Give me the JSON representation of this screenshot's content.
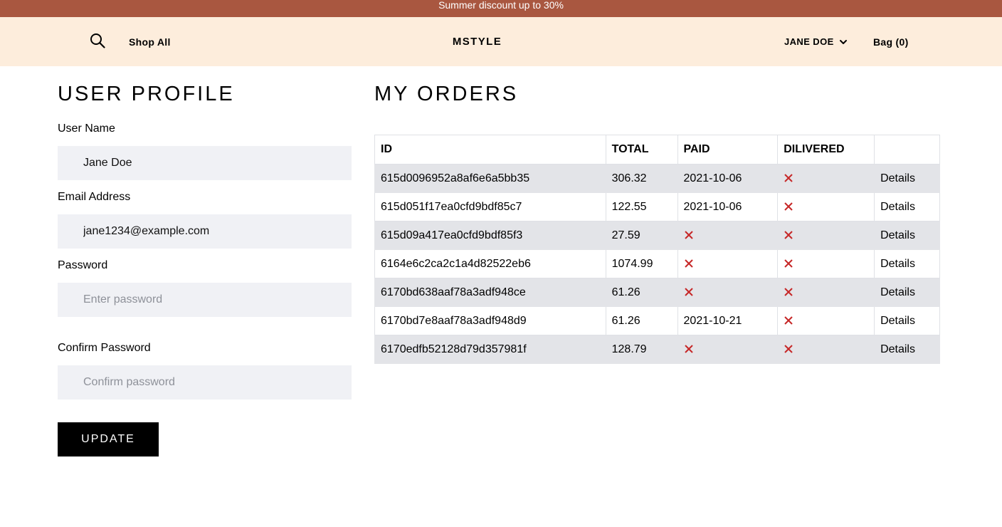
{
  "promo": {
    "text": "Summer discount up to 30%"
  },
  "header": {
    "shop_all": "Shop All",
    "brand": "MSTYLE",
    "user_name": "JANE DOE",
    "bag": "Bag (0)"
  },
  "profile": {
    "title": "USER PROFILE",
    "username_label": "User Name",
    "username_value": "Jane Doe",
    "email_label": "Email Address",
    "email_value": "jane1234@example.com",
    "password_label": "Password",
    "password_placeholder": "Enter password",
    "confirm_label": "Confirm Password",
    "confirm_placeholder": "Confirm password",
    "update_label": "UPDATE"
  },
  "orders": {
    "title": "MY ORDERS",
    "columns": [
      "ID",
      "TOTAL",
      "PAID",
      "DILIVERED",
      ""
    ],
    "rows": [
      {
        "id": "615d0096952a8af6e6a5bb35",
        "total": "306.32",
        "paid": "2021-10-06",
        "details": "Details"
      },
      {
        "id": "615d051f17ea0cfd9bdf85c7",
        "total": "122.55",
        "paid": "2021-10-06",
        "details": "Details"
      },
      {
        "id": "615d09a417ea0cfd9bdf85f3",
        "total": "27.59",
        "paid": null,
        "details": "Details"
      },
      {
        "id": "6164e6c2ca2c1a4d82522eb6",
        "total": "1074.99",
        "paid": null,
        "details": "Details"
      },
      {
        "id": "6170bd638aaf78a3adf948ce",
        "total": "61.26",
        "paid": null,
        "details": "Details"
      },
      {
        "id": "6170bd7e8aaf78a3adf948d9",
        "total": "61.26",
        "paid": "2021-10-21",
        "details": "Details"
      },
      {
        "id": "6170edfb52128d79d357981f",
        "total": "128.79",
        "paid": null,
        "details": "Details"
      }
    ]
  },
  "icons": {
    "search": "search-icon",
    "chevron": "chevron-down-icon",
    "not_done": "x-icon"
  },
  "colors": {
    "promo_bg": "#a95740",
    "header_bg": "#fdeddc",
    "x_mark": "#c62828",
    "input_bg": "#f0f1f5",
    "stripe": "#e3e4e8"
  }
}
